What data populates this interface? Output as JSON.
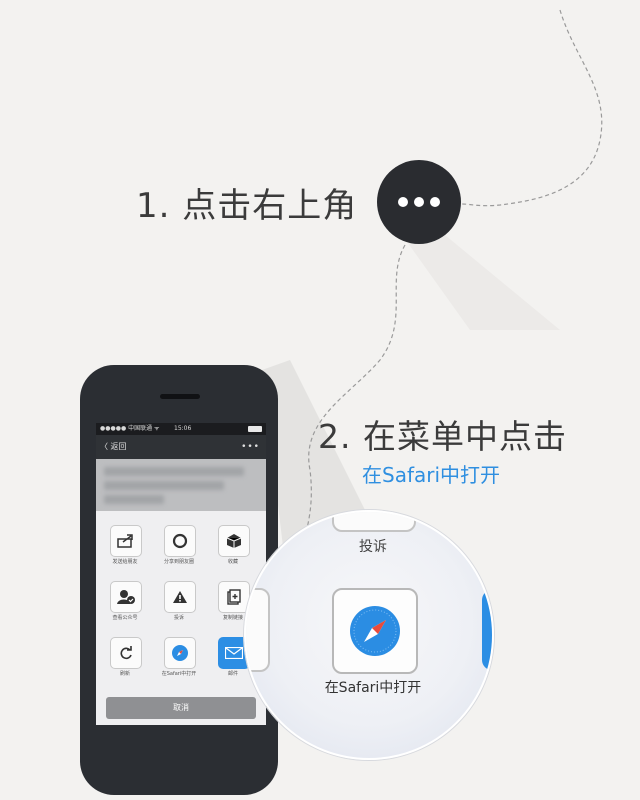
{
  "step1": {
    "text": "1. 点击右上角"
  },
  "step2": {
    "text": "2. 在菜单中点击",
    "subtext": "在Safari中打开"
  },
  "colors": {
    "background": "#f3f2f0",
    "accent": "#2f8fe0",
    "dark": "#2a2c30"
  },
  "phone": {
    "status": {
      "carrier": "●●●●● 中国联通 ᯤ",
      "time": "15:06"
    },
    "nav": {
      "back": "〈 返回",
      "more": "•••"
    },
    "menu": [
      {
        "label": "发送给朋友",
        "icon": "share-icon"
      },
      {
        "label": "分享到朋友圈",
        "icon": "moments-icon"
      },
      {
        "label": "收藏",
        "icon": "favorite-box-icon"
      },
      {
        "label": "查看公众号",
        "icon": "official-account-icon"
      },
      {
        "label": "投诉",
        "icon": "warning-icon"
      },
      {
        "label": "复制链接",
        "icon": "copy-link-icon"
      },
      {
        "label": "刷新",
        "icon": "refresh-icon"
      },
      {
        "label": "在Safari中打开",
        "icon": "safari-icon"
      },
      {
        "label": "邮件",
        "icon": "mail-icon"
      }
    ],
    "cancel": "取消"
  },
  "magnifier": {
    "top_label": "投诉",
    "safari_label": "在Safari中打开"
  }
}
